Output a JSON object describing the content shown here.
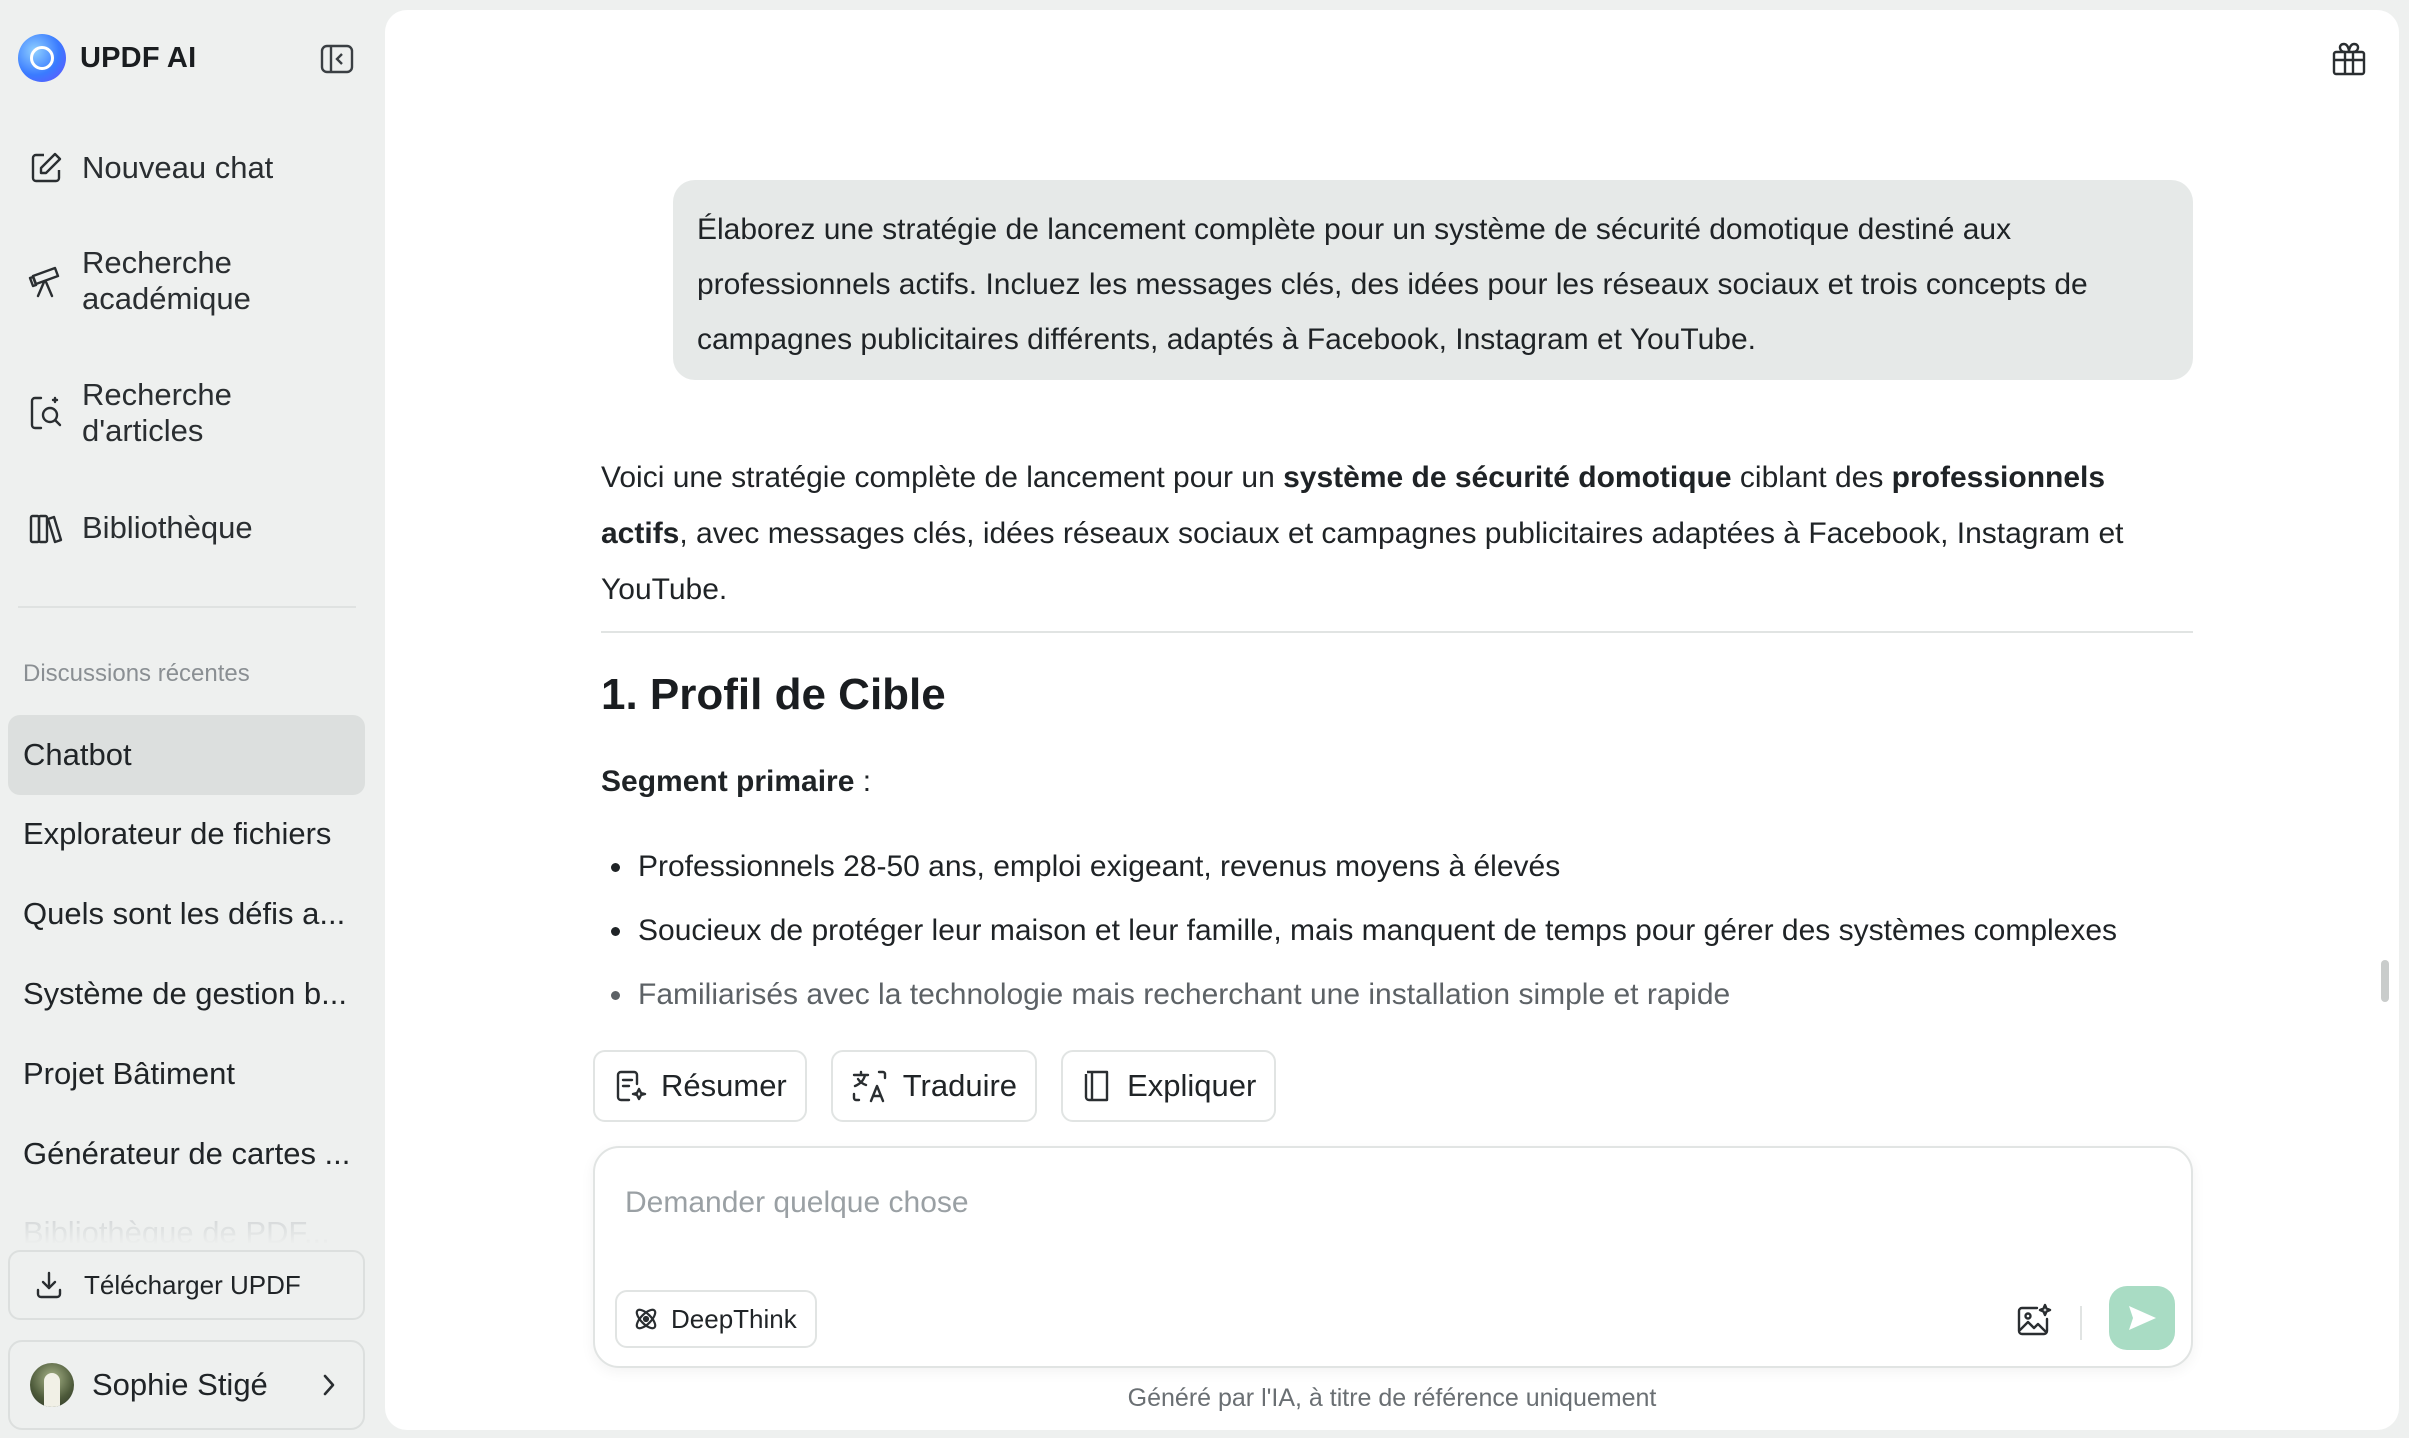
{
  "brand": {
    "name": "UPDF AI"
  },
  "nav": [
    {
      "label": "Nouveau chat",
      "icon": "edit-icon"
    },
    {
      "label": "Recherche\nacadémique",
      "line1": "Recherche",
      "line2": "académique",
      "icon": "telescope-icon"
    },
    {
      "label": "Recherche\nd'articles",
      "line1": "Recherche",
      "line2": "d'articles",
      "icon": "article-search-icon"
    },
    {
      "label": "Bibliothèque",
      "icon": "library-icon"
    }
  ],
  "recent": {
    "title": "Discussions récentes",
    "items": [
      "Chatbot",
      "Explorateur de fichiers",
      "Quels sont les défis a...",
      "Système de gestion b...",
      "Projet Bâtiment",
      "Générateur de cartes ..."
    ],
    "faded_item": "Bibliothèque de PDF...",
    "active_index": 0
  },
  "download": {
    "label": "Télécharger UPDF"
  },
  "user": {
    "name": "Sophie Stigé"
  },
  "conversation": {
    "user_message": "Élaborez une stratégie de lancement complète pour un système de sécurité domotique destiné aux professionnels actifs. Incluez les messages clés, des idées pour les réseaux sociaux et trois concepts de campagnes publicitaires différents, adaptés à Facebook, Instagram et YouTube.",
    "answer_intro": {
      "p1": "Voici une stratégie complète de lancement pour un ",
      "b1": "système de sécurité domotique",
      "p2": " ciblant des ",
      "b2": "professionnels actifs",
      "p3": ", avec messages clés, idées réseaux sociaux et campagnes publicitaires adaptées à Facebook, Instagram et YouTube."
    },
    "heading": "1. Profil de Cible",
    "segment_label": "Segment primaire",
    "segment_suffix": " :",
    "bullets": [
      "Professionnels 28-50 ans, emploi exigeant, revenus moyens à élevés",
      "Soucieux de protéger leur maison et leur famille, mais manquent de temps pour gérer des systèmes complexes",
      "Familiarisés avec la technologie mais recherchant une installation simple et rapide"
    ]
  },
  "quick_actions": [
    {
      "label": "Résumer",
      "icon": "summarize-icon"
    },
    {
      "label": "Traduire",
      "icon": "translate-icon"
    },
    {
      "label": "Expliquer",
      "icon": "book-icon"
    }
  ],
  "composer": {
    "placeholder": "Demander quelque chose",
    "deepthink_label": "DeepThink"
  },
  "disclaimer": "Généré par l'IA, à titre de référence uniquement",
  "colors": {
    "sidebar_bg": "#eef0ef",
    "panel_bg": "#ffffff",
    "user_bubble": "#e6e9e8",
    "send_button": "#a9dcc4"
  }
}
